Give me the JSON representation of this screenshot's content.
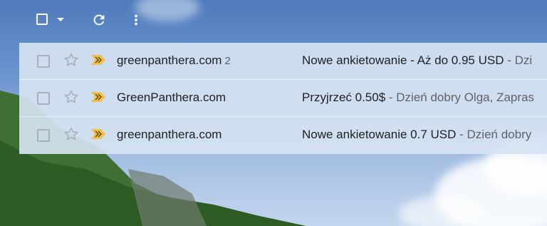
{
  "toolbar": {
    "select_icon": "checkbox-icon",
    "select_dropdown_icon": "caret-down-icon",
    "refresh_icon": "refresh-icon",
    "more_icon": "more-vert-icon"
  },
  "colors": {
    "important_marker": "#f2c04b",
    "list_background": "#d6e3f2",
    "sender_text": "#202124",
    "snippet_text": "#5f6368"
  },
  "emails": [
    {
      "sender": "greenpanthera.com",
      "count": "2",
      "subject": "Nowe ankietowanie - Aż do 0.95 USD",
      "snippet": " - Dzi"
    },
    {
      "sender": "GreenPanthera.com",
      "count": "",
      "subject": "Przyjrzeć 0.50$",
      "snippet": " - Dzień dobry Olga, Zapras"
    },
    {
      "sender": "greenpanthera.com",
      "count": "",
      "subject": "Nowe ankietowanie 0.7 USD",
      "snippet": " - Dzień dobry"
    }
  ]
}
